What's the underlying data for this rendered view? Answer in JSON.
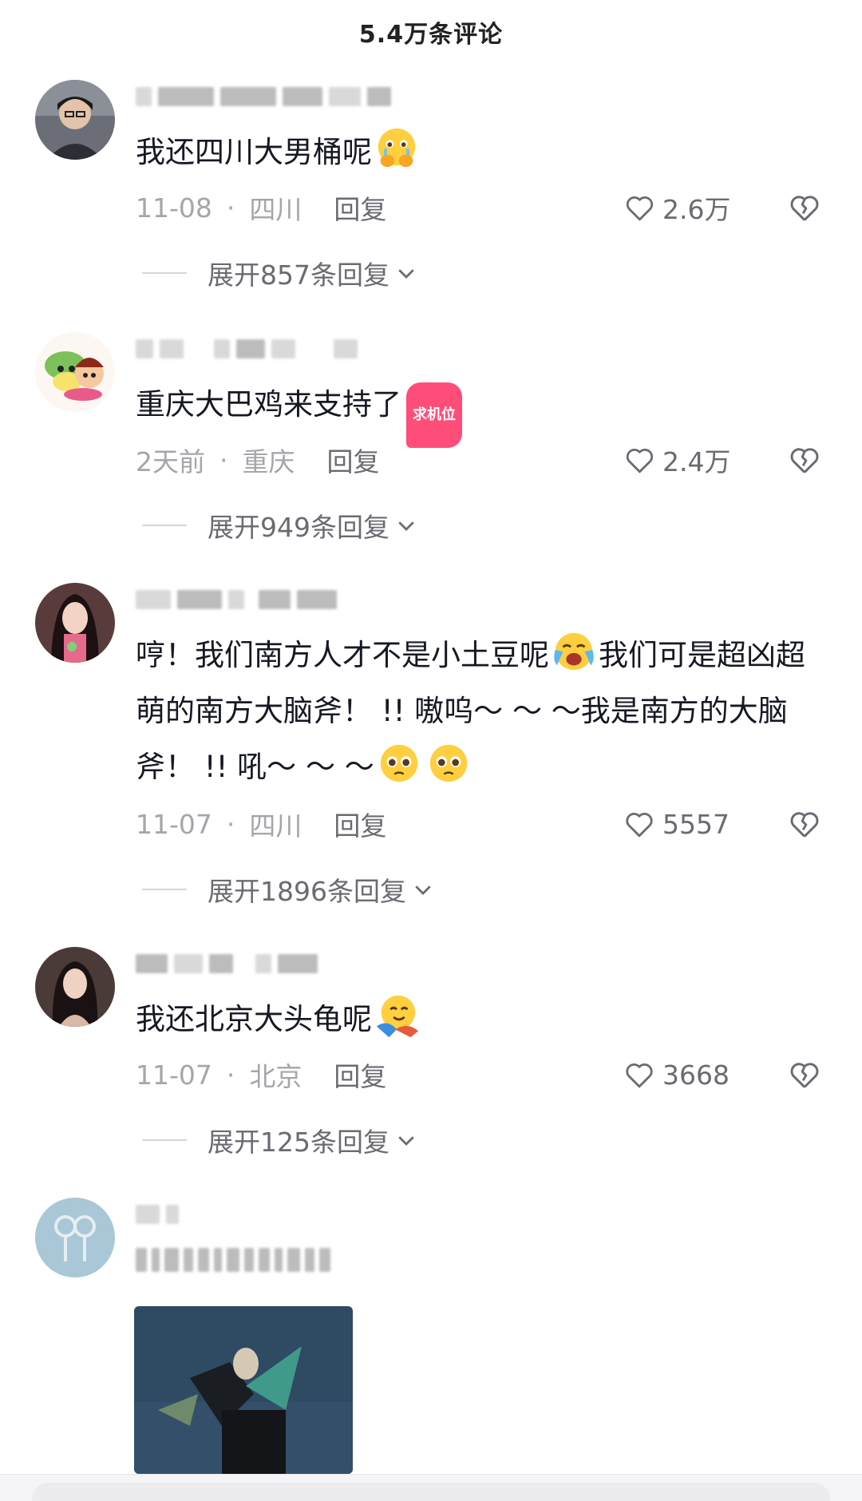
{
  "header": {
    "title": "5.4万条评论"
  },
  "comments": [
    {
      "text": "我还四川大男桶呢",
      "date": "11-08",
      "location": "四川",
      "reply_label": "回复",
      "likes": "2.6万",
      "expand": "展开857条回复",
      "emoji": "crying-hands-emoji"
    },
    {
      "text": "重庆大巴鸡来支持了",
      "sticker": "求机位",
      "date": "2天前",
      "location": "重庆",
      "reply_label": "回复",
      "likes": "2.4万",
      "expand": "展开949条回复"
    },
    {
      "text_parts": [
        "哼！我们南方人才不是小土豆呢",
        "我们可是超凶超萌的南方大脑斧！ !! 嗷呜～ ～ ～我是南方的大脑斧！ !! 吼～ ～ ～"
      ],
      "date": "11-07",
      "location": "四川",
      "reply_label": "回复",
      "likes": "5557",
      "expand": "展开1896条回复",
      "emojis": [
        "loudly-crying-emoji",
        "pleading-face-emoji",
        "pleading-face-emoji"
      ]
    },
    {
      "text": "我还北京大头龟呢",
      "date": "11-07",
      "location": "北京",
      "reply_label": "回复",
      "likes": "3668",
      "expand": "展开125条回复",
      "emoji": "hugging-emoji"
    },
    {
      "text": "",
      "has_media": true
    }
  ],
  "separator": "·",
  "colors": {
    "text": "#161823",
    "meta": "#a5a6ab",
    "action": "#6a6b72"
  }
}
